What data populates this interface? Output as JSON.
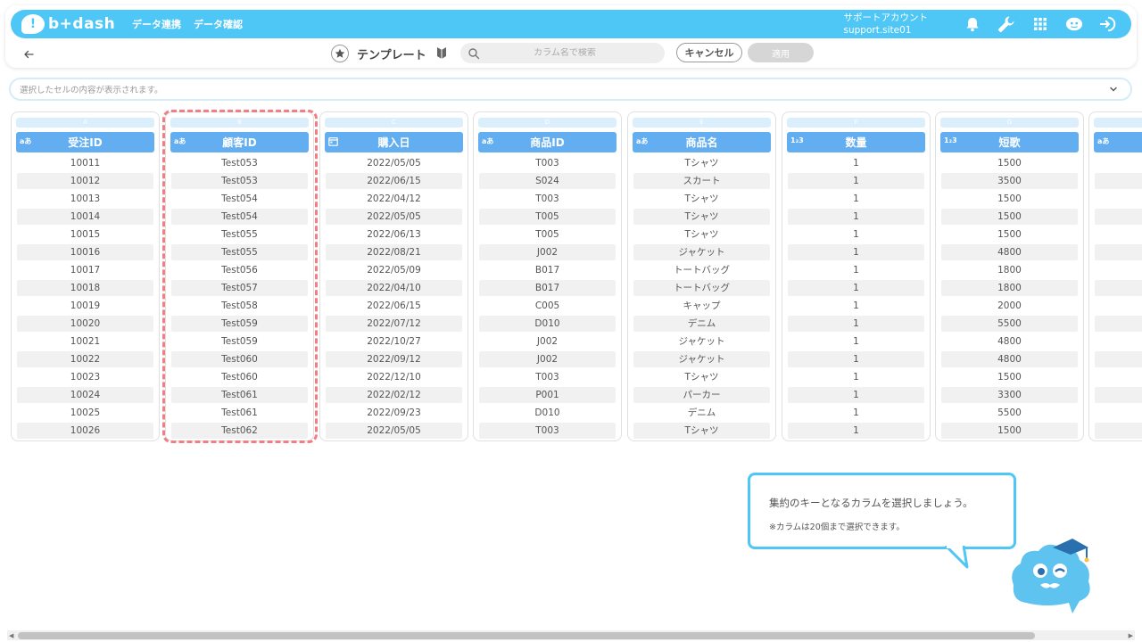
{
  "nav": {
    "logo_mark": "!",
    "logo_text": "b+dash",
    "links": [
      "データ連携",
      "データ確認"
    ],
    "account_line1": "サポートアカウント",
    "account_line2": "support.site01",
    "icons": [
      "bell-icon",
      "wrench-icon",
      "grid-icon",
      "mascot-icon",
      "logout-icon"
    ],
    "accent_color": "#4ec6f6"
  },
  "toolbar": {
    "title": "テンプレート",
    "search_placeholder": "カラム名で検索",
    "cancel_label": "キャンセル",
    "apply_label": "適用"
  },
  "cell_bar": {
    "placeholder": "選択したセルの内容が表示されます。"
  },
  "columns": [
    {
      "letter": "A",
      "type": "aあ",
      "name": "受注ID",
      "values": [
        "10011",
        "10012",
        "10013",
        "10014",
        "10015",
        "10016",
        "10017",
        "10018",
        "10019",
        "10020",
        "10021",
        "10022",
        "10023",
        "10024",
        "10025",
        "10026"
      ]
    },
    {
      "letter": "B",
      "type": "aあ",
      "name": "顧客ID",
      "values": [
        "Test053",
        "Test053",
        "Test054",
        "Test054",
        "Test055",
        "Test055",
        "Test056",
        "Test057",
        "Test058",
        "Test059",
        "Test059",
        "Test060",
        "Test060",
        "Test061",
        "Test061",
        "Test062"
      ]
    },
    {
      "letter": "C",
      "type": "calendar",
      "name": "購入日",
      "values": [
        "2022/05/05",
        "2022/06/15",
        "2022/04/12",
        "2022/05/05",
        "2022/06/13",
        "2022/08/21",
        "2022/05/09",
        "2022/04/10",
        "2022/06/15",
        "2022/07/12",
        "2022/10/27",
        "2022/09/12",
        "2022/12/10",
        "2022/02/12",
        "2022/09/23",
        "2022/05/05"
      ]
    },
    {
      "letter": "D",
      "type": "aあ",
      "name": "商品ID",
      "values": [
        "T003",
        "S024",
        "T003",
        "T005",
        "T005",
        "J002",
        "B017",
        "B017",
        "C005",
        "D010",
        "J002",
        "J002",
        "T003",
        "P001",
        "D010",
        "T003"
      ]
    },
    {
      "letter": "E",
      "type": "aあ",
      "name": "商品名",
      "values": [
        "Tシャツ",
        "スカート",
        "Tシャツ",
        "Tシャツ",
        "Tシャツ",
        "ジャケット",
        "トートバッグ",
        "トートバッグ",
        "キャップ",
        "デニム",
        "ジャケット",
        "ジャケット",
        "Tシャツ",
        "パーカー",
        "デニム",
        "Tシャツ"
      ]
    },
    {
      "letter": "F",
      "type": "1₂3",
      "name": "数量",
      "values": [
        "1",
        "1",
        "1",
        "1",
        "1",
        "1",
        "1",
        "1",
        "1",
        "1",
        "1",
        "1",
        "1",
        "1",
        "1",
        "1"
      ]
    },
    {
      "letter": "G",
      "type": "1₂3",
      "name": "短歌",
      "values": [
        "1500",
        "3500",
        "1500",
        "1500",
        "1500",
        "4800",
        "1800",
        "1800",
        "2000",
        "5500",
        "4800",
        "4800",
        "1500",
        "3300",
        "5500",
        "1500"
      ]
    }
  ],
  "partial_column": {
    "type": "aあ"
  },
  "bubble": {
    "main": "集約のキーとなるカラムを選択しましょう。",
    "sub": "※カラムは20個まで選択できます。"
  }
}
